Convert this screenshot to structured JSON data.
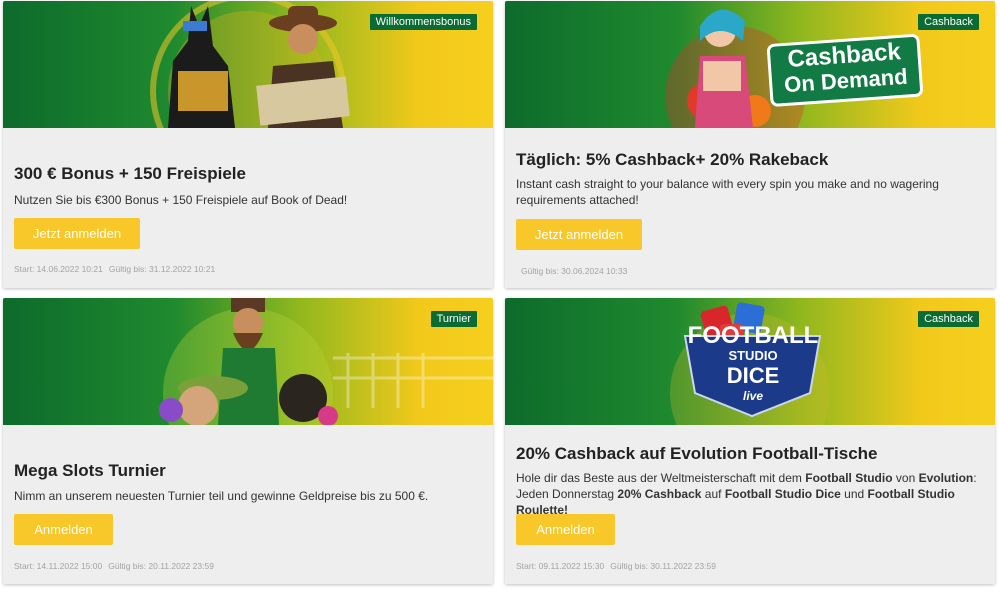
{
  "cards": [
    {
      "badge": "Willkommensbonus",
      "title": "300 € Bonus + 150 Freispiele",
      "description": "Nutzen Sie bis €300 Bonus + 150 Freispiele auf Book of Dead!",
      "button": "Jetzt anmelden",
      "start": "Start: 14.06.2022 10:21",
      "valid_until": "Gültig bis: 31.12.2022 10:21"
    },
    {
      "badge": "Cashback",
      "banner_text_1": "Cashback",
      "banner_text_2": "On Demand",
      "title": "Täglich: 5% Cashback+ 20% Rakeback",
      "description": "Instant cash straight to your balance with every spin you make and no wagering requirements attached!",
      "button": "Jetzt anmelden",
      "valid_until": "Gültig bis: 30.06.2024 10:33"
    },
    {
      "badge": "Turnier",
      "title": "Mega Slots Turnier",
      "description": "Nimm an unserem neuesten Turnier teil und gewinne Geldpreise bis zu 500 €.",
      "button": "Anmelden",
      "start": "Start: 14.11.2022 15:00",
      "valid_until": "Gültig bis: 20.11.2022 23:59"
    },
    {
      "badge": "Cashback",
      "banner_text_1": "FOOTBALL",
      "banner_text_2": "STUDIO",
      "banner_text_3": "DICE",
      "banner_text_4": "live",
      "title": "20% Cashback auf Evolution Football-Tische",
      "description_parts": {
        "p1": "Hole dir das Beste aus der Weltmeisterschaft mit dem ",
        "b1": "Football Studio",
        "p2": " von ",
        "b2": "Evolution",
        "p3": ": Jeden Donnerstag ",
        "b3": "20% Cashback",
        "p4": " auf ",
        "b4": "Football Studio Dice",
        "p5": " und ",
        "b5": "Football Studio Roulette!"
      },
      "button": "Anmelden",
      "start": "Start: 09.11.2022 15:30",
      "valid_until": "Gültig bis: 30.11.2022 23:59"
    }
  ],
  "colors": {
    "badge_bg": "#0a6b33",
    "button_bg": "#f8c72a",
    "card_bg": "#eeeeee",
    "banner_green": "#0d6b2c",
    "banner_yellow": "#f6cf1e"
  }
}
